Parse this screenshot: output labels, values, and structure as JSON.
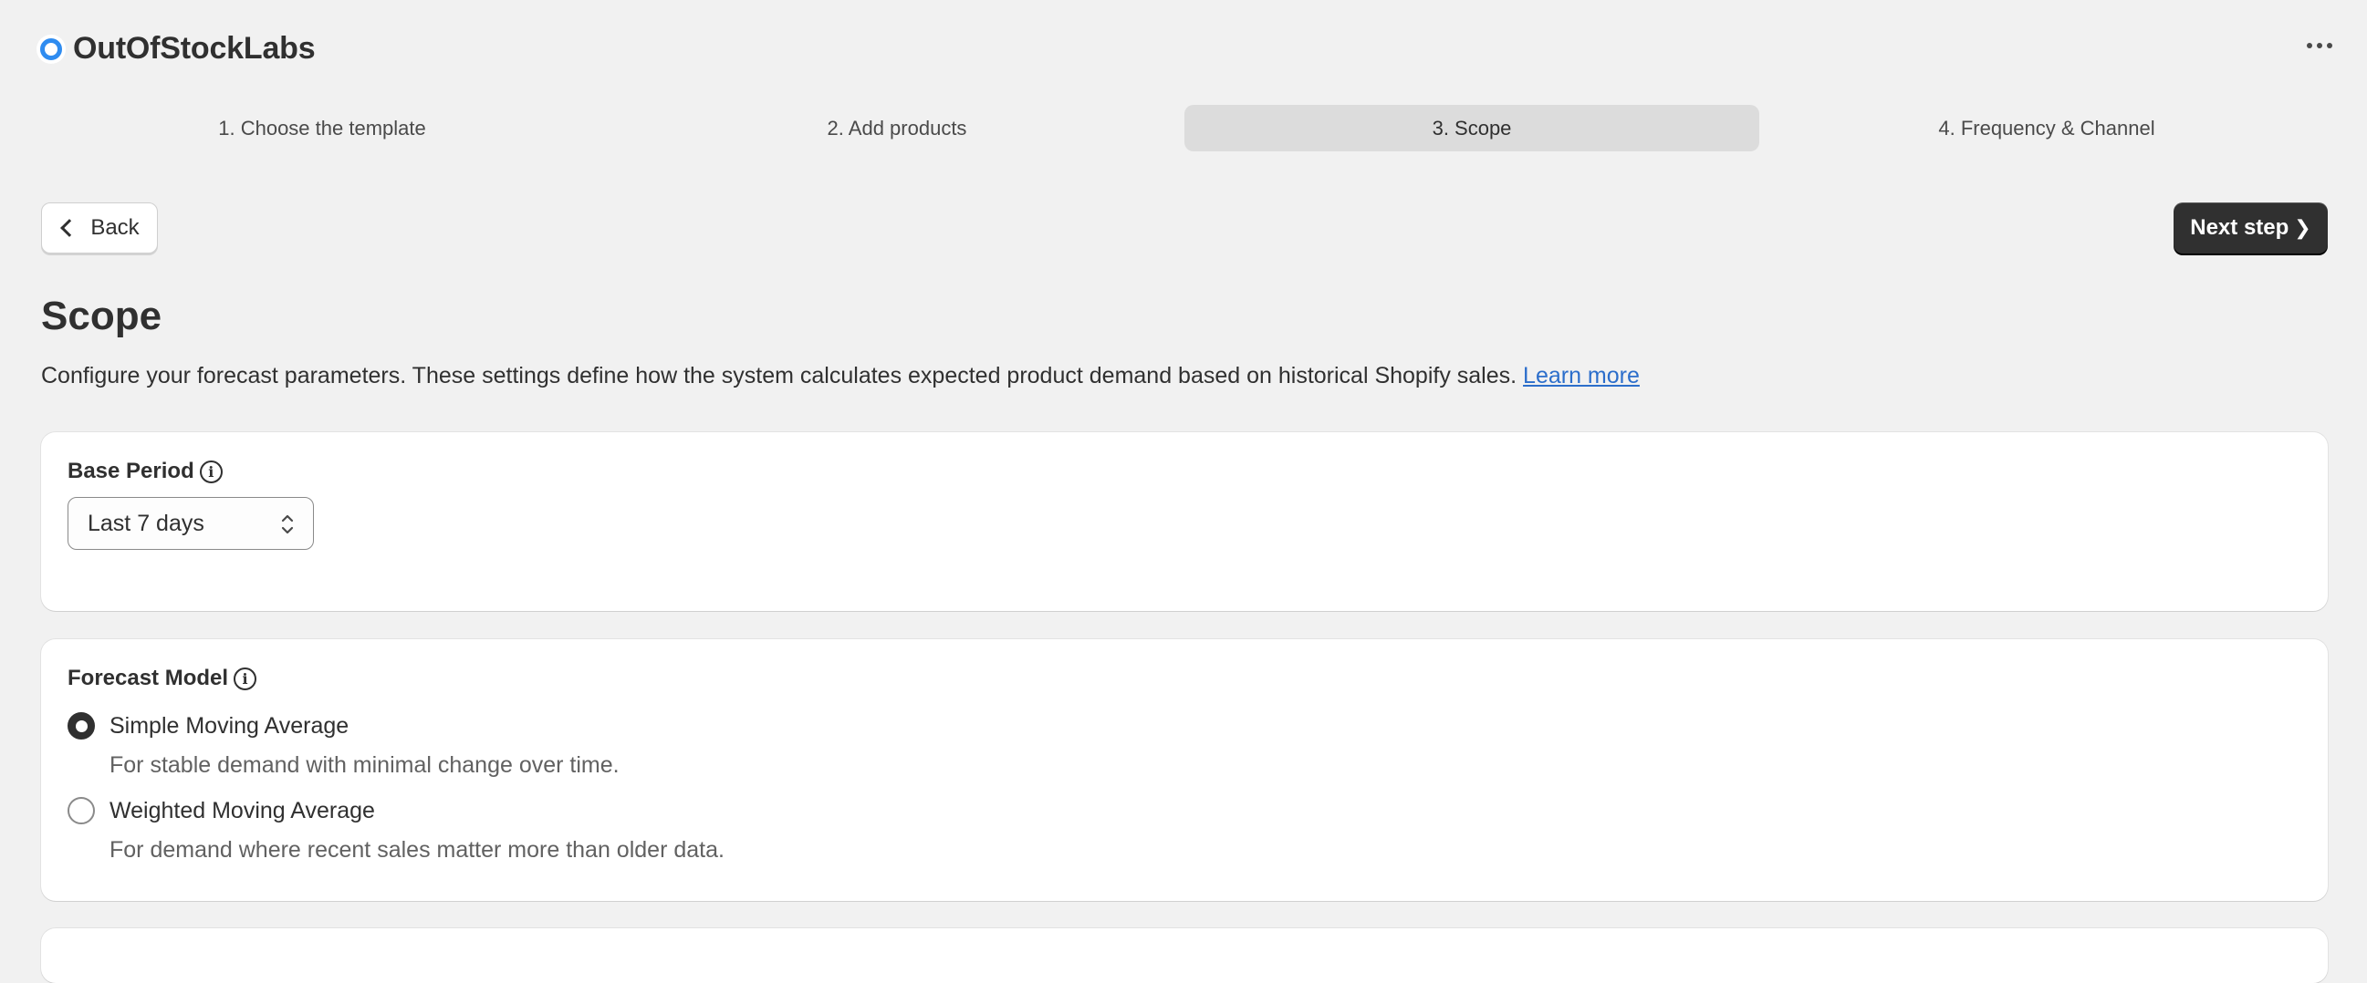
{
  "app": {
    "title": "OutOfStockLabs",
    "logo_icon": "circle-logo-icon",
    "accent": "#2f8cf0"
  },
  "steps": [
    {
      "label": "1. Choose the template",
      "active": false
    },
    {
      "label": "2. Add products",
      "active": false
    },
    {
      "label": "3. Scope",
      "active": true
    },
    {
      "label": "4. Frequency & Channel",
      "active": false
    }
  ],
  "nav": {
    "back_label": "Back",
    "next_label": "Next step",
    "next_icon": "❯"
  },
  "page": {
    "title": "Scope",
    "description": "Configure your forecast parameters. These settings define how the system calculates expected product demand based on historical Shopify sales.",
    "learn_more": "Learn more"
  },
  "base_period": {
    "label": "Base Period",
    "info_icon": "i",
    "selected": "Last 7 days"
  },
  "forecast_model": {
    "label": "Forecast Model",
    "info_icon": "i",
    "options": [
      {
        "label": "Simple Moving Average",
        "help": "For stable demand with minimal change over time.",
        "checked": true
      },
      {
        "label": "Weighted Moving Average",
        "help": "For demand where recent sales matter more than older data.",
        "checked": false
      }
    ]
  }
}
